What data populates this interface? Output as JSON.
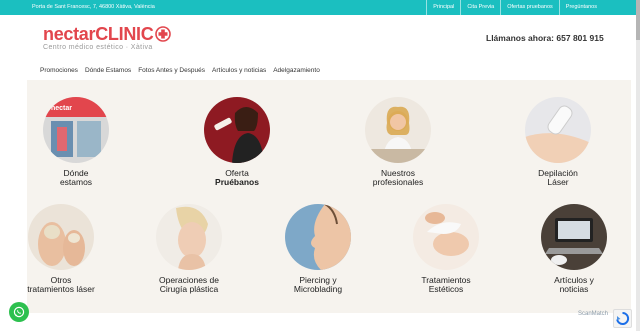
{
  "topbar": {
    "address": "Porta de Sant Francesc, 7, 46800 Xàtiva, València",
    "links": [
      "Principal",
      "Cita Previa",
      "Ofertas pruebanos",
      "Pregúntanos"
    ]
  },
  "logo": {
    "nectar": "nectar",
    "clinic": "CLINIC",
    "tagline": "Centro médico estético · Xàtiva"
  },
  "phone": {
    "label": "Llámanos ahora:",
    "number": "657 801 915"
  },
  "nav": [
    "Promociones",
    "Dónde Estamos",
    "Fotos Antes y Después",
    "Artículos y noticias",
    "Adelgazamiento"
  ],
  "services": [
    {
      "line1": "Dónde",
      "line2": "estamos",
      "bold2": false
    },
    {
      "line1": "Oferta",
      "line2": "Pruébanos",
      "bold2": true
    },
    {
      "line1": "Nuestros",
      "line2": "profesionales",
      "bold2": false
    },
    {
      "line1": "Depilación",
      "line2": "Láser",
      "bold2": false
    },
    {
      "line1": "Otros",
      "line2": "tratamientos láser",
      "bold2": false
    },
    {
      "line1": "Operaciones de",
      "line2": "Cirugía plástica",
      "bold2": false
    },
    {
      "line1": "Piercing y",
      "line2": "Microblading",
      "bold2": false
    },
    {
      "line1": "Tratamientos",
      "line2": "Estéticos",
      "bold2": false
    },
    {
      "line1": "Artículos y",
      "line2": "noticias",
      "bold2": false
    }
  ],
  "scanmatch": "ScanMatch",
  "colors": {
    "accent": "#1bbfc0",
    "brand": "#e2464d",
    "whatsapp": "#2dc04f"
  },
  "icons": {
    "whatsapp": "whatsapp-icon",
    "recaptcha": "recaptcha-icon"
  }
}
